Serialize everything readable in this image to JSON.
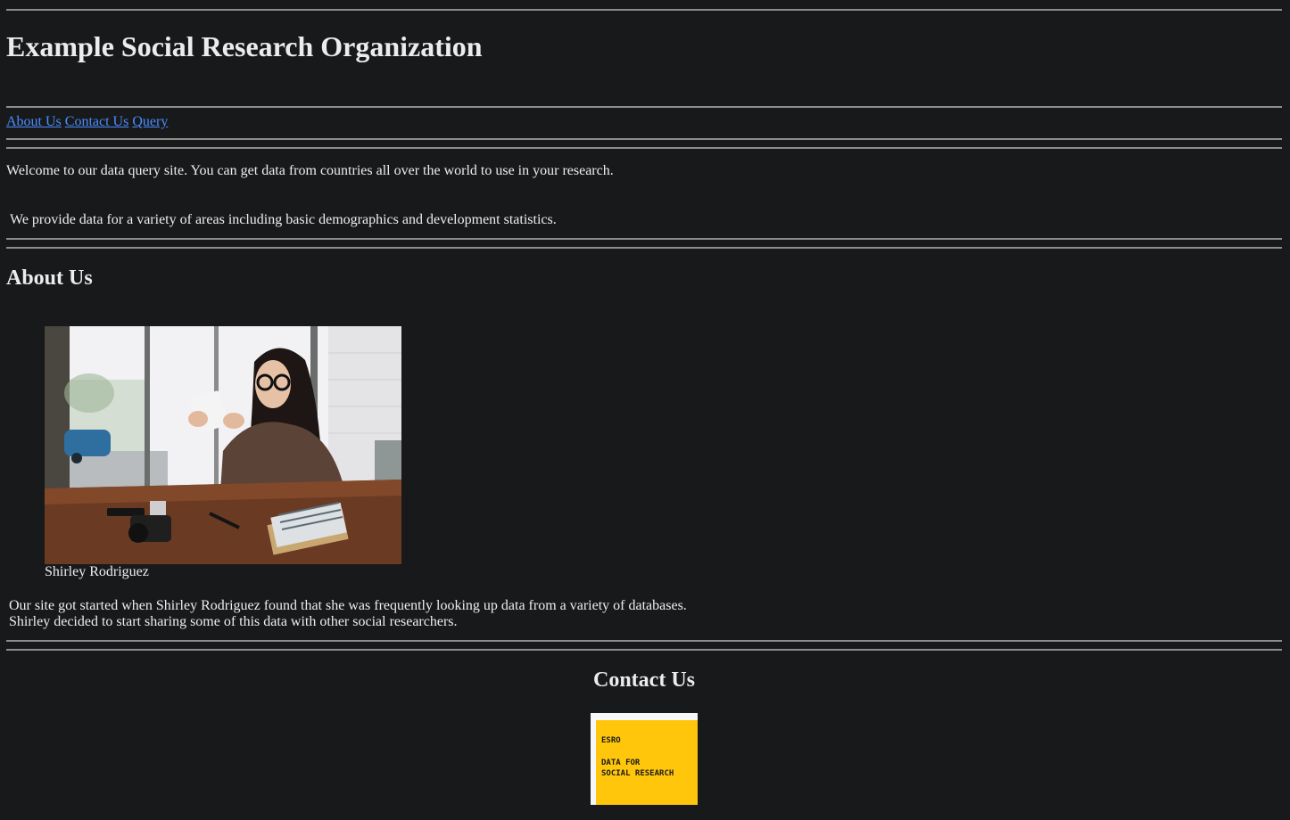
{
  "header": {
    "title": "Example Social Research Organization"
  },
  "nav": {
    "items": [
      {
        "label": "About Us"
      },
      {
        "label": "Contact Us"
      },
      {
        "label": "Query"
      }
    ]
  },
  "intro": {
    "line1": "Welcome to our data query site. You can get data from countries all over the world to use in your research.",
    "line2": "We provide data for a variety of areas including basic demographics and development statistics."
  },
  "about": {
    "heading": "About Us",
    "photo_caption": "Shirley Rodriguez",
    "para_line1": "Our site got started when Shirley Rodriguez found that she was frequently looking up data from a variety of databases.",
    "para_line2": "Shirley decided to start sharing some of this data with other social researchers."
  },
  "contact": {
    "heading": "Contact Us",
    "logo": {
      "line1": "ESRO",
      "line2": "DATA FOR",
      "line3": "SOCIAL RESEARCH"
    }
  },
  "colors": {
    "background": "#18191b",
    "link": "#4a8dff",
    "rule": "#8c8c8c",
    "logo_yellow": "#ffc60b"
  }
}
